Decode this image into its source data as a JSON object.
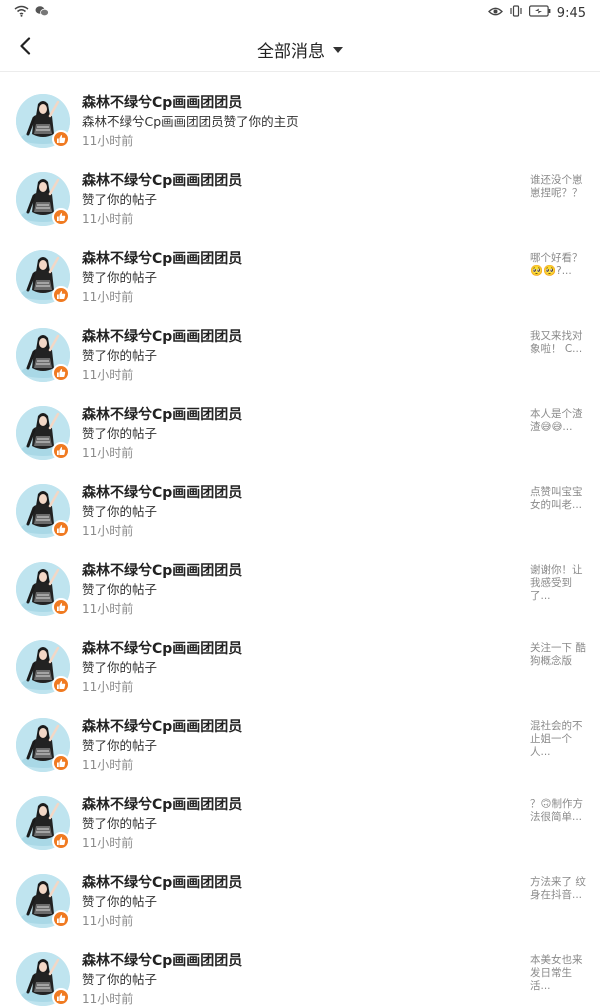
{
  "status_bar": {
    "time": "9:45",
    "icons": [
      "wifi-icon",
      "wechat-icon",
      "eye-icon",
      "vibrate-icon",
      "battery-icon"
    ]
  },
  "nav": {
    "title": "全部消息",
    "back_icon": "back-arrow-icon",
    "dropdown_icon": "caret-down-icon"
  },
  "colors": {
    "accent": "#f07a21",
    "divider": "#ececec",
    "secondary_text": "#8a8a8a"
  },
  "notifications": [
    {
      "name": "森林不绿兮Cp画画团团员",
      "action": "森林不绿兮Cp画画团团员赞了你的主页",
      "time": "11小时前",
      "preview": ""
    },
    {
      "name": "森林不绿兮Cp画画团团员",
      "action": "赞了你的帖子",
      "time": "11小时前",
      "preview": "谁还没个崽崽捏呢？？"
    },
    {
      "name": "森林不绿兮Cp画画团团员",
      "action": "赞了你的帖子",
      "time": "11小时前",
      "preview": "哪个好看？🥺🥺?..."
    },
    {
      "name": "森林不绿兮Cp画画团团员",
      "action": "赞了你的帖子",
      "time": "11小时前",
      "preview": "我又来找对象啦！ C..."
    },
    {
      "name": "森林不绿兮Cp画画团团员",
      "action": "赞了你的帖子",
      "time": "11小时前",
      "preview": "本人是个渣渣😅😅..."
    },
    {
      "name": "森林不绿兮Cp画画团团员",
      "action": "赞了你的帖子",
      "time": "11小时前",
      "preview": "点赞叫宝宝女的叫老..."
    },
    {
      "name": "森林不绿兮Cp画画团团员",
      "action": "赞了你的帖子",
      "time": "11小时前",
      "preview": "谢谢你！让我感受到了..."
    },
    {
      "name": "森林不绿兮Cp画画团团员",
      "action": "赞了你的帖子",
      "time": "11小时前",
      "preview": "关注一下 酷狗概念版"
    },
    {
      "name": "森林不绿兮Cp画画团团员",
      "action": "赞了你的帖子",
      "time": "11小时前",
      "preview": "混社会的不止姐一个人..."
    },
    {
      "name": "森林不绿兮Cp画画团团员",
      "action": "赞了你的帖子",
      "time": "11小时前",
      "preview": "？🙃制作方法很简单..."
    },
    {
      "name": "森林不绿兮Cp画画团团员",
      "action": "赞了你的帖子",
      "time": "11小时前",
      "preview": "方法来了 纹身在抖音..."
    },
    {
      "name": "森林不绿兮Cp画画团团员",
      "action": "赞了你的帖子",
      "time": "11小时前",
      "preview": "本美女也来发日常生活..."
    }
  ]
}
